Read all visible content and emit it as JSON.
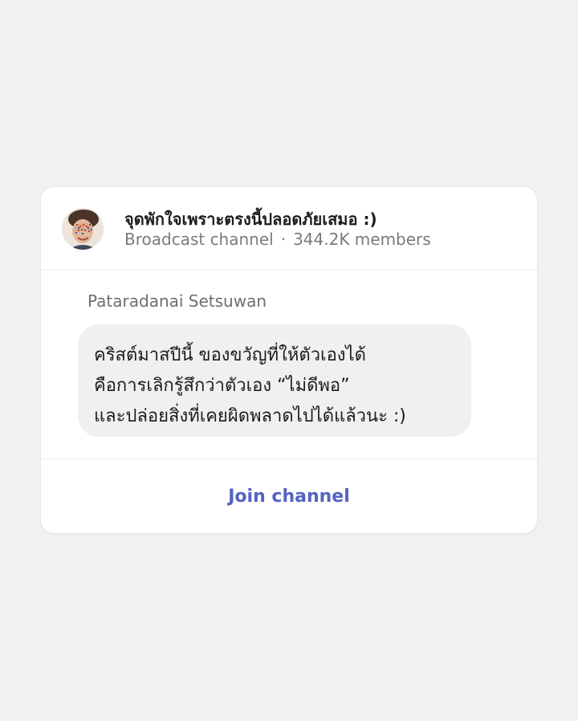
{
  "channel": {
    "name": "จุดพักใจเพราะตรงนี้ปลอดภัยเสมอ :)",
    "type": "Broadcast channel",
    "separator": "·",
    "members": "344.2K members",
    "avatar_icon": "profile-photo-avatar"
  },
  "message": {
    "sender": "Pataradanai Setsuwan",
    "lines": [
      "คริสต์มาสปีนี้ ของขวัญที่ให้ตัวเองได้",
      "คือการเลิกรู้สึกว่าตัวเอง “ไม่ดีพอ”",
      "และปล่อยสิ่งที่เคยผิดพลาดไปได้แล้วนะ :)"
    ]
  },
  "actions": {
    "join_label": "Join channel"
  },
  "colors": {
    "background": "#f1f1f2",
    "card": "#ffffff",
    "bubble": "#f0f0f2",
    "accent": "#5563c1",
    "meta_text": "#7a7a80"
  }
}
